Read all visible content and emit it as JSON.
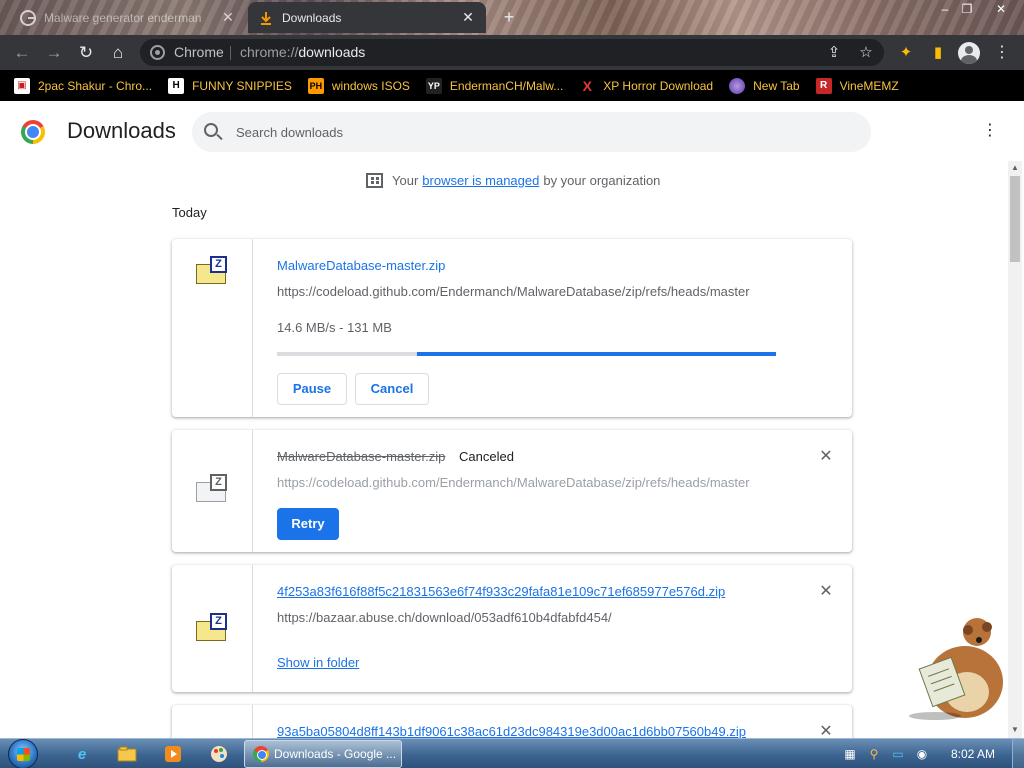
{
  "browser": {
    "tabs": [
      {
        "title": "Malware generator enderman",
        "active": false
      },
      {
        "title": "Downloads",
        "active": true
      }
    ],
    "omnibox": {
      "chip": "Chrome",
      "url_prefix": "chrome://",
      "url_host": "downloads"
    },
    "bookmarks": [
      {
        "label": "2pac Shakur - Chro...",
        "icon": "generic-page-icon"
      },
      {
        "label": "FUNNY SNIPPIES",
        "icon": "H"
      },
      {
        "label": "windows ISOS",
        "icon": "PH"
      },
      {
        "label": "EndermanCH/Malw...",
        "icon": "YP"
      },
      {
        "label": "XP Horror Download",
        "icon": "X"
      },
      {
        "label": "New Tab",
        "icon": "globe-icon"
      },
      {
        "label": "VineMEMZ",
        "icon": "R"
      }
    ]
  },
  "page": {
    "title": "Downloads",
    "search_placeholder": "Search downloads",
    "managed": {
      "prefix": "Your",
      "link": "browser is managed",
      "suffix": "by your organization"
    },
    "section": "Today"
  },
  "downloads": [
    {
      "filename": "MalwareDatabase-master.zip",
      "url": "https://codeload.github.com/Endermanch/MalwareDatabase/zip/refs/heads/master",
      "speed": "14.6 MB/s - 131 MB",
      "progress": 0.72,
      "pause_label": "Pause",
      "cancel_label": "Cancel"
    },
    {
      "filename": "MalwareDatabase-master.zip",
      "status": "Canceled",
      "url": "https://codeload.github.com/Endermanch/MalwareDatabase/zip/refs/heads/master",
      "retry_label": "Retry"
    },
    {
      "filename": "4f253a83f616f88f5c21831563e6f74f933c29fafa81e109c71ef685977e576d.zip",
      "url": "https://bazaar.abuse.ch/download/053adf610b4dfabfd454/",
      "show_label": "Show in folder"
    },
    {
      "filename": "93a5ba05804d8ff143b1df9061c38ac61d23dc984319e3d00ac1d6bb07560b49.zip"
    }
  ],
  "taskbar": {
    "task_label": "Downloads - Google ...",
    "clock": "8:02 AM"
  }
}
